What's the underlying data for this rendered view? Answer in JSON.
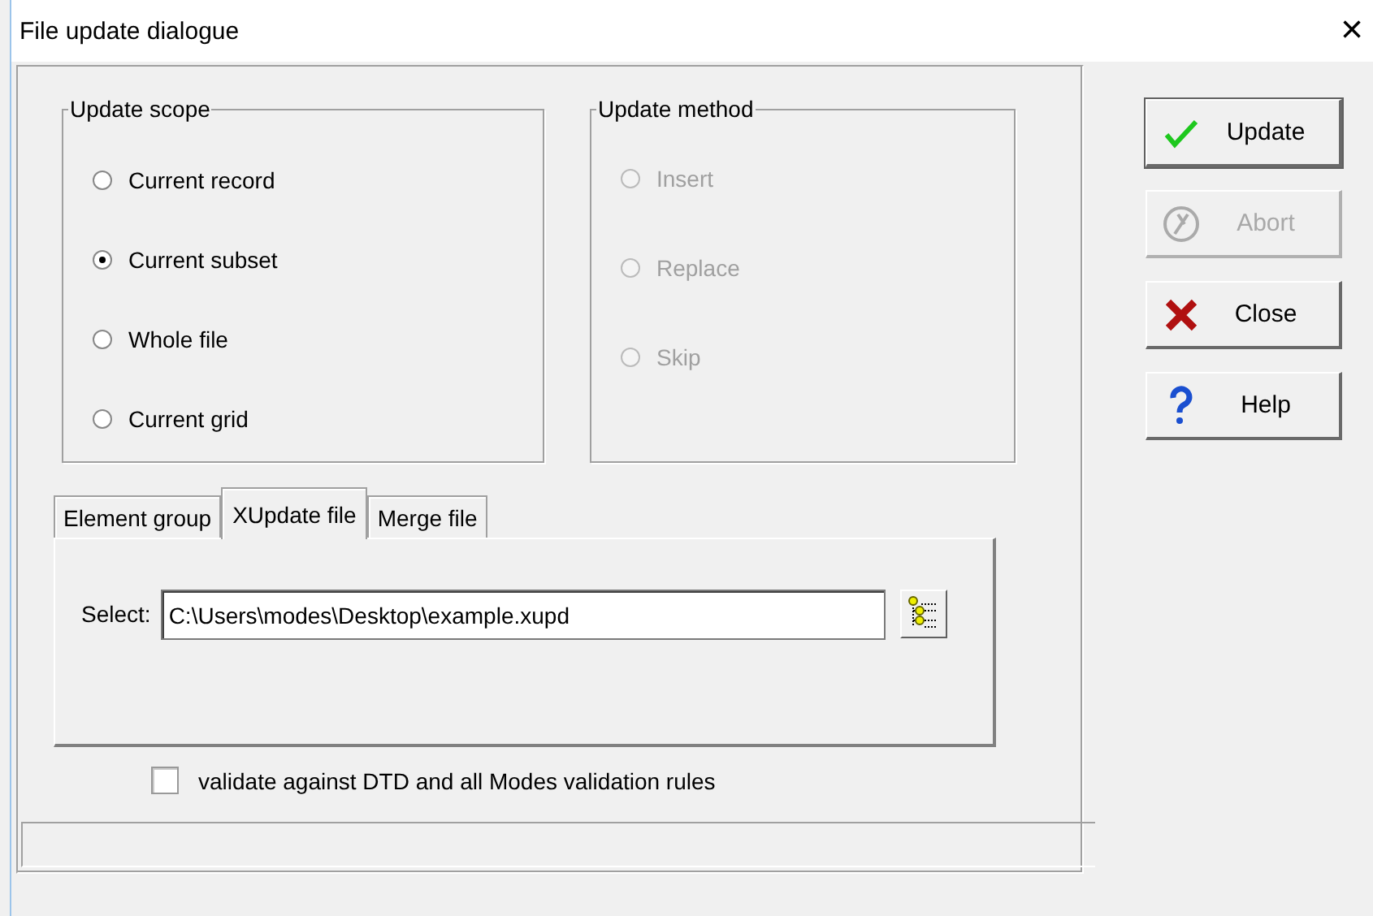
{
  "window": {
    "title": "File update dialogue",
    "close": "×"
  },
  "update_scope": {
    "title": "Update scope",
    "options": [
      {
        "label": "Current record",
        "selected": false,
        "disabled": false
      },
      {
        "label": "Current subset",
        "selected": true,
        "disabled": false
      },
      {
        "label": "Whole file",
        "selected": false,
        "disabled": false
      },
      {
        "label": "Current grid",
        "selected": false,
        "disabled": false
      }
    ]
  },
  "update_method": {
    "title": "Update method",
    "options": [
      {
        "label": "Insert",
        "selected": false,
        "disabled": true
      },
      {
        "label": "Replace",
        "selected": false,
        "disabled": true
      },
      {
        "label": "Skip",
        "selected": false,
        "disabled": true
      }
    ]
  },
  "buttons": [
    {
      "label": "Update",
      "kind": "check",
      "disabled": false,
      "default": true
    },
    {
      "label": "Abort",
      "kind": "abort",
      "disabled": true,
      "default": false
    },
    {
      "label": "Close",
      "kind": "cross",
      "disabled": false,
      "default": false
    },
    {
      "label": "Help",
      "kind": "help",
      "disabled": false,
      "default": false
    }
  ],
  "tabs": [
    {
      "label": "Element group",
      "selected": false
    },
    {
      "label": "XUpdate file",
      "selected": true
    },
    {
      "label": "Merge file",
      "selected": false
    }
  ],
  "select": {
    "label": "Select:",
    "value": "C:\\Users\\modes\\Desktop\\example.xupd"
  },
  "validate": {
    "label": "validate against DTD and all Modes validation rules",
    "checked": false
  }
}
